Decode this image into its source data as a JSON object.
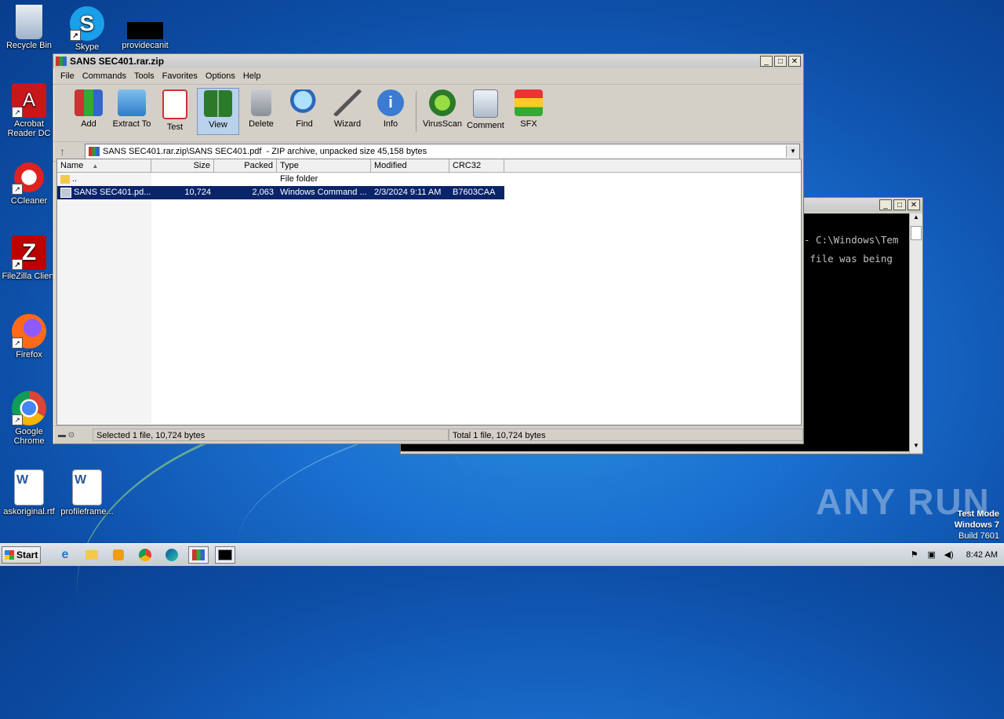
{
  "desktop": {
    "icons": [
      {
        "label": "Recycle Bin"
      },
      {
        "label": "Skype"
      },
      {
        "label": "providecanit"
      },
      {
        "label": "Acrobat Reader DC"
      },
      {
        "label": "CCleaner"
      },
      {
        "label": "FileZilla Client"
      },
      {
        "label": "Firefox"
      },
      {
        "label": "Google Chrome"
      },
      {
        "label": "askoriginal.rtf"
      },
      {
        "label": "profileframe..."
      }
    ]
  },
  "winrar": {
    "title": "SANS SEC401.rar.zip",
    "menu": [
      "File",
      "Commands",
      "Tools",
      "Favorites",
      "Options",
      "Help"
    ],
    "toolbar": [
      {
        "label": "Add",
        "icon": "add-icon"
      },
      {
        "label": "Extract To",
        "icon": "extract-icon"
      },
      {
        "label": "Test",
        "icon": "test-icon"
      },
      {
        "label": "View",
        "icon": "view-icon"
      },
      {
        "label": "Delete",
        "icon": "delete-icon"
      },
      {
        "label": "Find",
        "icon": "find-icon"
      },
      {
        "label": "Wizard",
        "icon": "wizard-icon"
      },
      {
        "label": "Info",
        "icon": "info-icon"
      },
      {
        "label": "VirusScan",
        "icon": "virusscan-icon"
      },
      {
        "label": "Comment",
        "icon": "comment-icon"
      },
      {
        "label": "SFX",
        "icon": "sfx-icon"
      }
    ],
    "address": "SANS SEC401.rar.zip\\SANS SEC401.pdf  - ZIP archive, unpacked size 45,158 bytes",
    "columns": [
      "Name",
      "Size",
      "Packed",
      "Type",
      "Modified",
      "CRC32"
    ],
    "rows": [
      {
        "name": "..",
        "size": "",
        "packed": "",
        "type": "File folder",
        "modified": "",
        "crc": ""
      },
      {
        "name": "SANS SEC401.pd...",
        "size": "10,724",
        "packed": "2,063",
        "type": "Windows Command ...",
        "modified": "2/3/2024 9:11 AM",
        "crc": "B7603CAA"
      }
    ],
    "status_left": "Selected 1 file, 10,724 bytes",
    "status_right": "Total 1 file, 10,724 bytes"
  },
  "console": {
    "line1": "- C:\\Windows\\Tem",
    "line2": " file was being"
  },
  "taskbar": {
    "start": "Start",
    "clock": "8:42 AM"
  },
  "watermark": "ANY RUN",
  "os": {
    "line1": "Test Mode",
    "line2": "Windows 7",
    "line3": "Build 7601"
  }
}
